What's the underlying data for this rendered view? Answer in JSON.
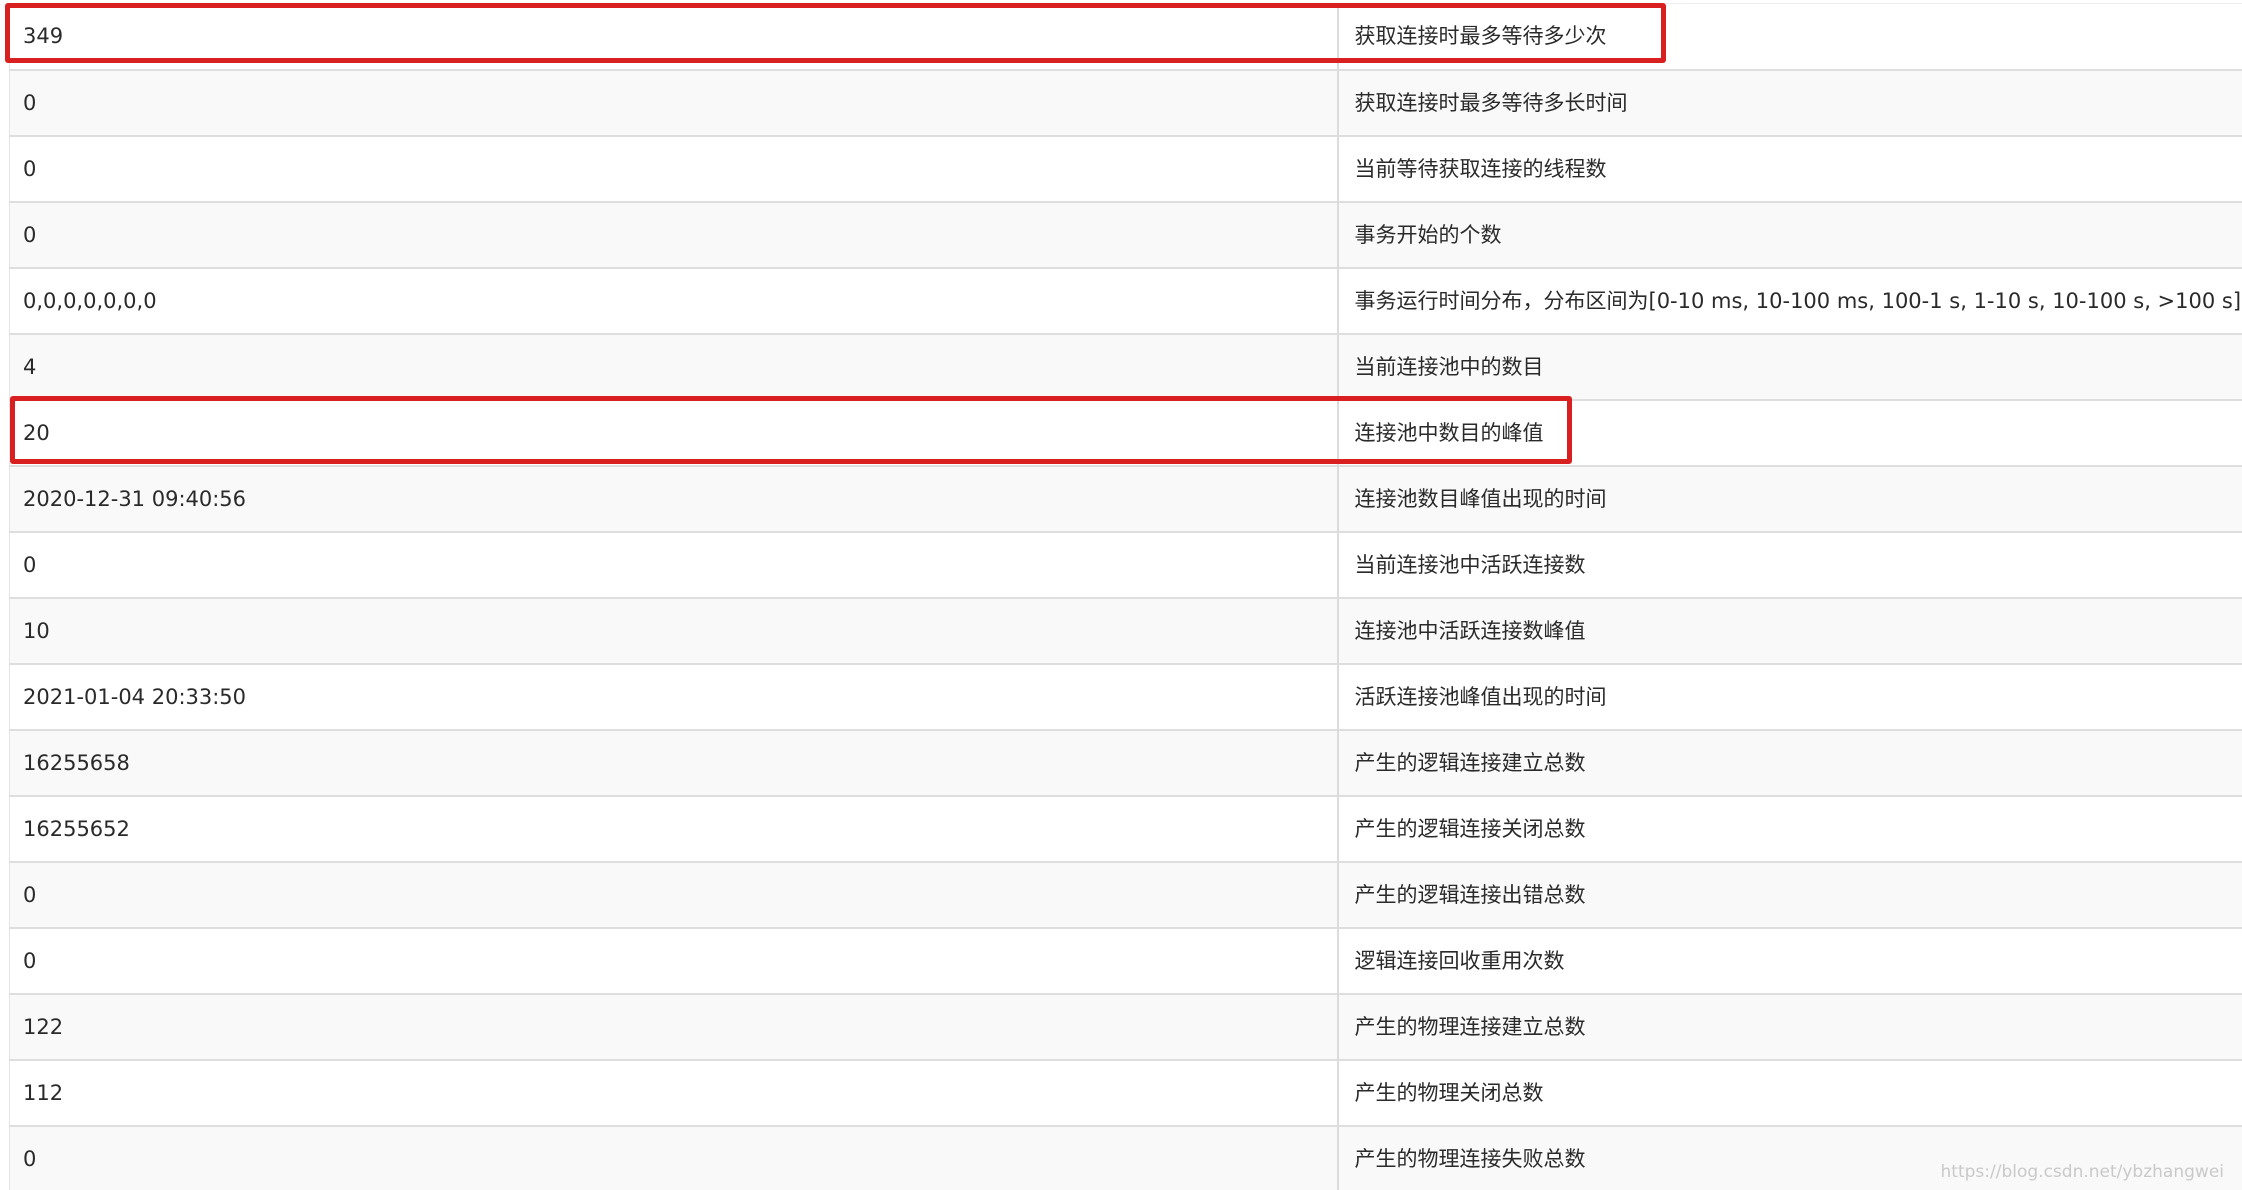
{
  "rows": [
    {
      "value": "349",
      "desc": "获取连接时最多等待多少次"
    },
    {
      "value": "0",
      "desc": "获取连接时最多等待多长时间"
    },
    {
      "value": "0",
      "desc": "当前等待获取连接的线程数"
    },
    {
      "value": "0",
      "desc": "事务开始的个数"
    },
    {
      "value": "0,0,0,0,0,0,0",
      "desc": "事务运行时间分布，分布区间为[0-10 ms, 10-100 ms, 100-1 s, 1-10 s, 10-100 s, >100 s]"
    },
    {
      "value": "4",
      "desc": "当前连接池中的数目"
    },
    {
      "value": "20",
      "desc": "连接池中数目的峰值"
    },
    {
      "value": "2020-12-31 09:40:56",
      "desc": "连接池数目峰值出现的时间"
    },
    {
      "value": "0",
      "desc": "当前连接池中活跃连接数"
    },
    {
      "value": "10",
      "desc": "连接池中活跃连接数峰值"
    },
    {
      "value": "2021-01-04 20:33:50",
      "desc": "活跃连接池峰值出现的时间"
    },
    {
      "value": "16255658",
      "desc": "产生的逻辑连接建立总数"
    },
    {
      "value": "16255652",
      "desc": "产生的逻辑连接关闭总数"
    },
    {
      "value": "0",
      "desc": "产生的逻辑连接出错总数"
    },
    {
      "value": "0",
      "desc": "逻辑连接回收重用次数"
    },
    {
      "value": "122",
      "desc": "产生的物理连接建立总数"
    },
    {
      "value": "112",
      "desc": "产生的物理关闭总数"
    },
    {
      "value": "0",
      "desc": "产生的物理连接失败总数"
    }
  ],
  "watermark": "https://blog.csdn.net/ybzhangwei",
  "colors": {
    "highlight": "#d7201f",
    "row_alt": "#f9f9f9",
    "border": "#dedede"
  }
}
